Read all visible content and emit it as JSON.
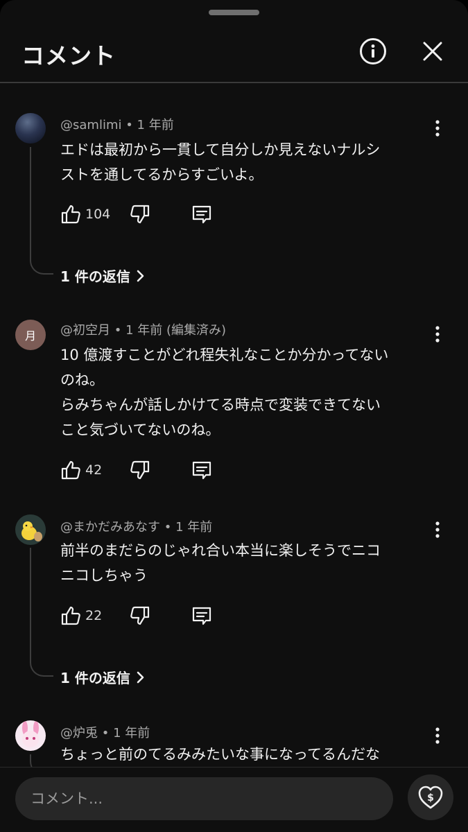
{
  "header": {
    "title": "コメント",
    "info_icon": "info-circle-icon",
    "close_icon": "close-icon"
  },
  "comments": [
    {
      "author": "@samlimi",
      "time": "1 年前",
      "edited": "",
      "avatar_text": "",
      "text": "エドは最初から一貫して自分しか見えないナルシ\nストを通してるからすごいよ。",
      "likes": "104",
      "replies_label": "1 件の返信"
    },
    {
      "author": "@初空月",
      "time": "1 年前",
      "edited": "(編集済み)",
      "avatar_text": "月",
      "text": "10 億渡すことがどれ程失礼なことか分かってない\nのね。\nらみちゃんが話しかけてる時点で変装できてない\nこと気づいてないのね。",
      "likes": "42",
      "replies_label": ""
    },
    {
      "author": "@まかだみあなす",
      "time": "1 年前",
      "edited": "",
      "avatar_text": "",
      "text": "前半のまだらのじゃれ合い本当に楽しそうでニコ\nニコしちゃう",
      "likes": "22",
      "replies_label": "1 件の返信"
    },
    {
      "author": "@炉兎",
      "time": "1 年前",
      "edited": "",
      "avatar_text": "",
      "text": "ちょっと前のてるみみたいな事になってるんだな",
      "likes": "",
      "replies_label": ""
    }
  ],
  "composer": {
    "placeholder": "コメント...",
    "thanks_icon": "super-thanks-heart-dollar-icon"
  },
  "colors": {
    "background": "#0f0f0f",
    "text": "#f1f1f1",
    "secondary_text": "#aaaaaa",
    "input_bg": "#272727"
  }
}
